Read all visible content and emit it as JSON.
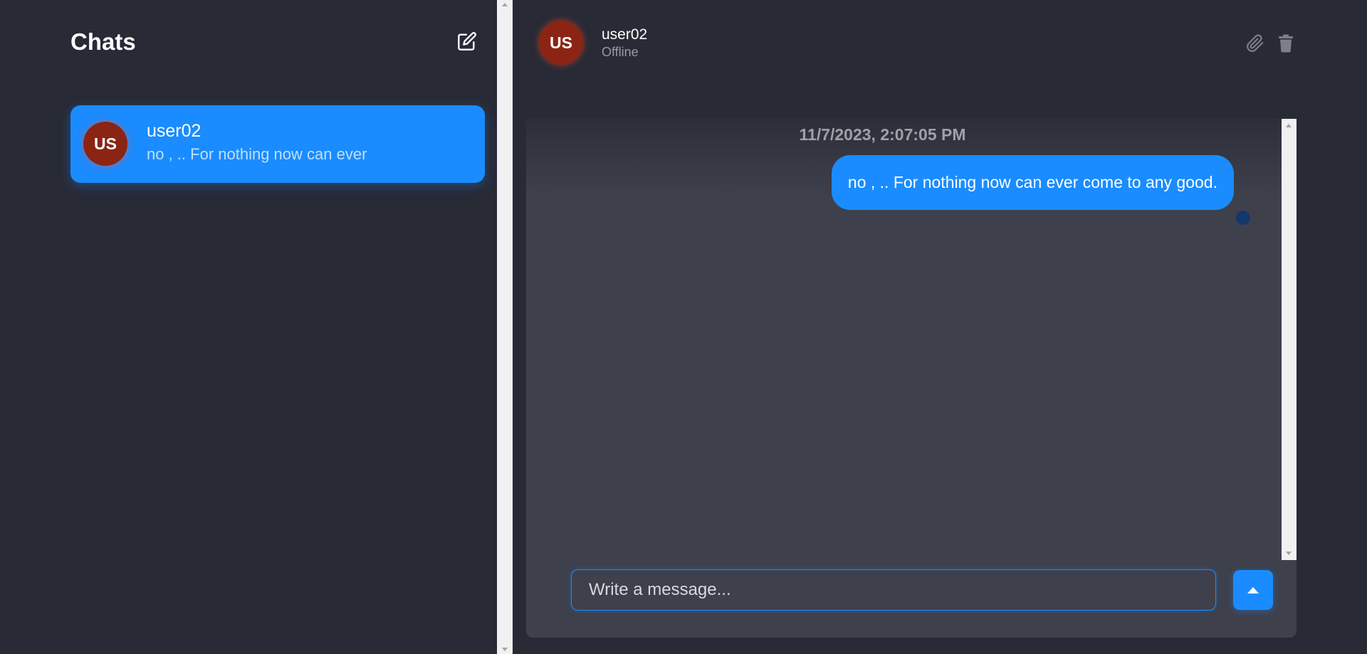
{
  "sidebar": {
    "title": "Chats",
    "new_chat_icon": "edit-icon",
    "chats": [
      {
        "avatar_initials": "US",
        "name": "user02",
        "preview": "no , .. For nothing now can ever"
      }
    ]
  },
  "header": {
    "avatar_initials": "US",
    "name": "user02",
    "status": "Offline",
    "attach_icon": "paperclip-icon",
    "delete_icon": "trash-icon"
  },
  "messages": [
    {
      "timestamp": "11/7/2023, 2:07:05 PM",
      "text": "no , .. For nothing now can ever come to any good."
    }
  ],
  "composer": {
    "placeholder": "Write a message...",
    "send_icon": "send-arrow-up-icon"
  },
  "colors": {
    "background": "#282a36",
    "panel": "#3e404c",
    "accent": "#1a8cff",
    "avatar": "#8b2412",
    "muted_text": "#9a9aa4"
  }
}
